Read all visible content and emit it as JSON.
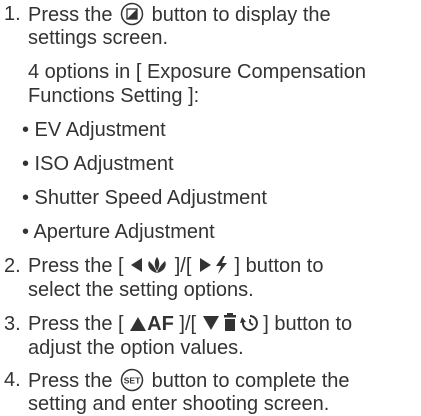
{
  "steps": [
    {
      "number": "1.",
      "line1_before": "Press the",
      "icon": "exposure-compensation-icon",
      "line1_after": "button to display the",
      "line2": "settings screen.",
      "sub_intro_1": "4 options in [ Exposure Compensation",
      "sub_intro_2": "Functions Setting ]:",
      "bullets": [
        "• EV Adjustment",
        "• ISO Adjustment",
        "• Shutter Speed Adjustment",
        "• Aperture Adjustment"
      ]
    },
    {
      "number": "2.",
      "part1": "Press the [",
      "icon_a": "left-arrow-macro-icon",
      "part2": "]/[",
      "icon_b": "right-arrow-flash-icon",
      "part3": "] button to",
      "line2": "select the setting options."
    },
    {
      "number": "3.",
      "part1": "Press the [",
      "icon_a": "up-arrow-af-icon",
      "af_label": "AF",
      "part2": "]/[",
      "icon_b": "down-arrow-delete-timer-icon",
      "part3": "] button to",
      "line2": "adjust the option values."
    },
    {
      "number": "4.",
      "line1_before": "Press the",
      "icon": "set-button-icon",
      "set_label": "SET",
      "line1_after": "button to complete the",
      "line2": "setting and enter shooting screen."
    }
  ]
}
